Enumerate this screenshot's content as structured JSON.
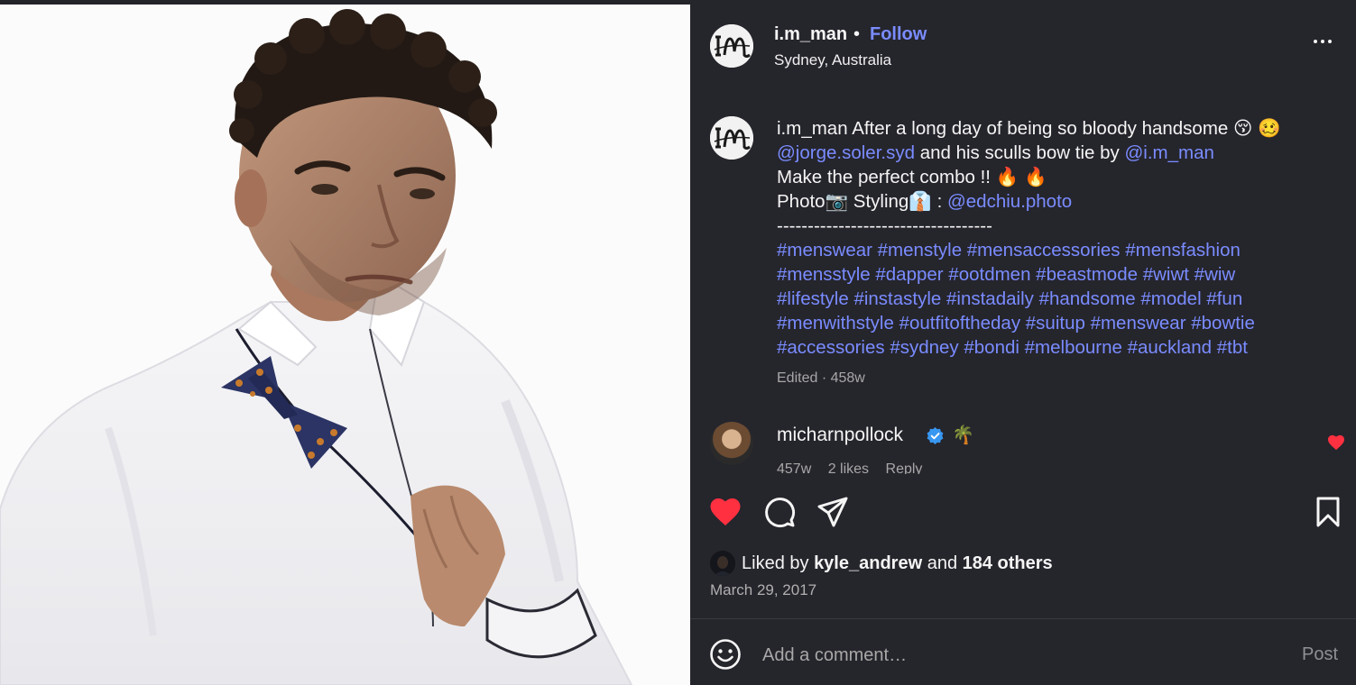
{
  "post": {
    "username": "i.m_man",
    "separator": "•",
    "follow_label": "Follow",
    "location": "Sydney, Australia",
    "photo_alt": "man in white shirt with skull bow tie"
  },
  "caption": {
    "username": "i.m_man",
    "line1_text": "After a long day of being so bloody handsome",
    "line1_emoji": "😚 🥴",
    "line2_mention1": "@jorge.soler.syd",
    "line2_text": " and his sculls bow tie by ",
    "line2_mention2": "@i.m_man",
    "line3_text": "Make the perfect combo !!",
    "line3_emoji": "🔥 🔥",
    "line4_photo": "Photo",
    "line4_camera": "📷",
    "line4_styling": " Styling",
    "line4_suit": "👔",
    "line4_colon": " : ",
    "line4_mention": "@edchiu.photo",
    "dashes": "-----------------------------------",
    "hashtag_lines": [
      "#menswear #menstyle #mensaccessories #mensfashion",
      "#mensstyle #dapper #ootdmen #beastmode #wiwt #wiw",
      "#lifestyle #instastyle #instadaily #handsome #model #fun",
      "#menwithstyle #outfitoftheday #suitup #menswear #bowtie",
      "#accessories #sydney #bondi #melbourne #auckland #tbt"
    ],
    "meta": "Edited · 458w"
  },
  "comment": {
    "username": "micharnpollock",
    "emoji": "🌴",
    "age": "457w",
    "likes": "2 likes",
    "reply": "Reply"
  },
  "actions": {
    "liked": true,
    "icons": [
      "heart-icon",
      "comment-icon",
      "share-icon",
      "bookmark-icon"
    ]
  },
  "likes": {
    "prefix": "Liked by ",
    "user": "kyle_andrew",
    "middle": " and ",
    "others": "184 others"
  },
  "date": "March 29, 2017",
  "add_comment": {
    "placeholder": "Add a comment…",
    "post_label": "Post"
  },
  "colors": {
    "panel_bg": "#25252c",
    "link": "#7a8cff",
    "like_red": "#ff3040",
    "verified_blue": "#3897f0"
  }
}
